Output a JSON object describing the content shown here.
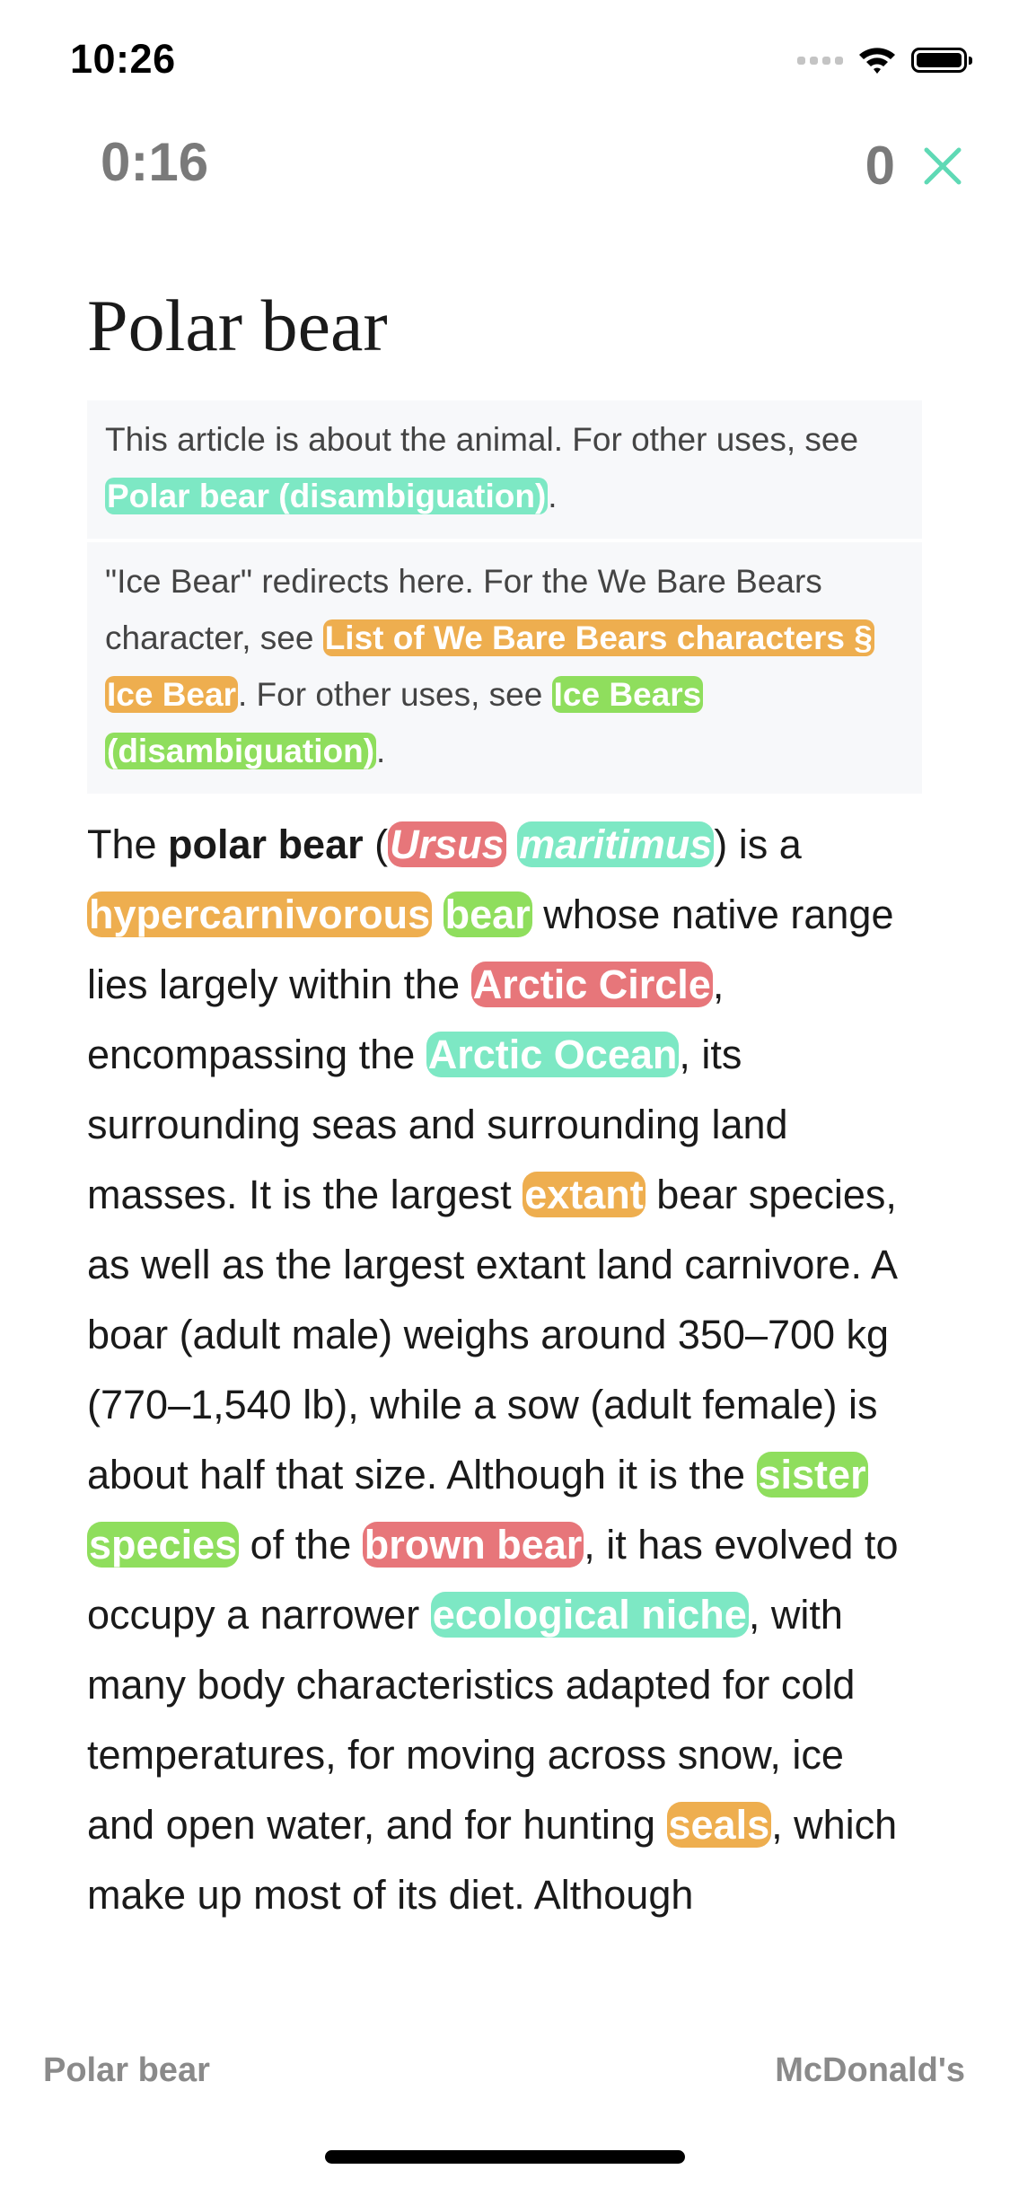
{
  "status_bar": {
    "time": "10:26"
  },
  "game": {
    "timer": "0:16",
    "score": "0",
    "close_icon": "close-x-icon",
    "accent_color": "#5fd9b5"
  },
  "article": {
    "title": "Polar bear",
    "hatnote1": {
      "t1": "This article is about the animal. For other uses, see ",
      "link1": "Polar bear (disambiguation)",
      "t2": "."
    },
    "hatnote2": {
      "t1": "\"Ice Bear\" redirects here. For the We Bare Bears character, see ",
      "link1": "List of We Bare Bears characters § Ice Bear",
      "t2": ". For other uses, see ",
      "link2": "Ice Bears (disambiguation)",
      "t3": "."
    },
    "lead": {
      "t1": "The ",
      "bold1": "polar bear",
      "t2": " (",
      "l_ursus": "Ursus",
      "t3": " ",
      "l_maritimus": "maritimus",
      "t4": ") is a ",
      "l_hypercarnivorous": "hypercarnivorous",
      "t5": " ",
      "l_bear": "bear",
      "t6": " whose native range lies largely within the ",
      "l_arctic_circle": "Arctic Circle",
      "t7": ", encompassing the ",
      "l_arctic_ocean": "Arctic Ocean",
      "t8": ", its surrounding seas and surrounding land masses. It is the largest ",
      "l_extant": "extant",
      "t9": " bear species, as well as the largest extant land carnivore. A boar (adult male) weighs around 350–700 kg (770–1,540 lb), while a sow (adult female) is about half that size. Although it is the ",
      "l_sister_species": "sister species",
      "t10": " of the ",
      "l_brown_bear": "brown bear",
      "t11": ", it has evolved to occupy a narrower ",
      "l_ecological_niche": "ecological niche",
      "t12": ", with many body characteristics adapted for cold temperatures, for moving across snow, ice and open water, and for hunting ",
      "l_seals": "seals",
      "t13": ", which make up most of its diet. Although"
    }
  },
  "footer": {
    "start": "Polar bear",
    "target": "McDonald's"
  },
  "link_colors": {
    "teal": "#7de8c4",
    "orange": "#eeae4f",
    "green": "#8fde5d",
    "red": "#e7767a"
  }
}
